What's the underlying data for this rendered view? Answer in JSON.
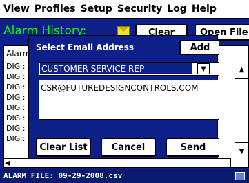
{
  "menubar": {
    "items": [
      "View",
      "Profiles",
      "Setup",
      "Security",
      "Log",
      "Help"
    ]
  },
  "background": {
    "title": "Alarm History:",
    "clear_label": "Clear",
    "open_file_label": "Open File",
    "list_header": "Alarm",
    "row_prefix": "DIG :",
    "rows": [
      "DIG :",
      "DIG :",
      "DIG :",
      "DIG :",
      "DIG :",
      "DIG :",
      "DIG :",
      "DIG :"
    ]
  },
  "status_bar": {
    "text": "ALARM FILE: 09-29-2008.csv"
  },
  "dialog": {
    "title": "Select Email Address",
    "add_label": "Add",
    "recipient_selected": "CUSTOMER SERVICE REP",
    "email_address": "CSR@FUTUREDESIGNCONTROLS.COM",
    "clear_list_label": "Clear List",
    "cancel_label": "Cancel",
    "send_label": "Send"
  },
  "colors": {
    "background_blue": "#0d1f8a",
    "title_green": "#00ff00",
    "selection_blue": "#0d1f8a"
  },
  "icons": [
    "envelope-icon",
    "dropdown-arrow-icon",
    "scroll-up-icon",
    "scroll-down-icon",
    "scroll-left-icon",
    "device-icon"
  ]
}
